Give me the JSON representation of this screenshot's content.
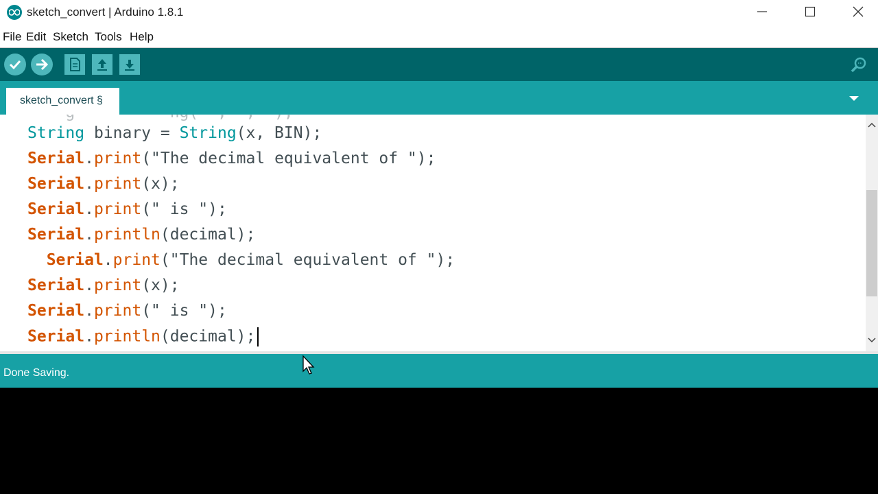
{
  "window": {
    "title": "sketch_convert | Arduino 1.8.1",
    "app_icon": "arduino-infinity-icon",
    "controls": [
      "minimize-icon",
      "maximize-icon",
      "close-icon"
    ]
  },
  "menu": [
    "File",
    "Edit",
    "Sketch",
    "Tools",
    "Help"
  ],
  "toolbar": {
    "buttons": [
      "verify-icon",
      "upload-icon",
      "new-icon",
      "open-icon",
      "save-icon"
    ],
    "right": "serial-monitor-icon"
  },
  "tabs": [
    {
      "label": "sketch_convert §"
    }
  ],
  "editor": {
    "lines": [
      [
        {
          "t": "String",
          "c": "ty"
        },
        {
          "t": " binary = "
        },
        {
          "t": "String",
          "c": "ty"
        },
        {
          "t": "(x, BIN);"
        }
      ],
      [
        {
          "t": "Serial",
          "c": "kw"
        },
        {
          "t": "."
        },
        {
          "t": "print",
          "c": "fn"
        },
        {
          "t": "(\"The decimal equivalent of \");"
        }
      ],
      [
        {
          "t": "Serial",
          "c": "kw"
        },
        {
          "t": "."
        },
        {
          "t": "print",
          "c": "fn"
        },
        {
          "t": "(x);"
        }
      ],
      [
        {
          "t": "Serial",
          "c": "kw"
        },
        {
          "t": "."
        },
        {
          "t": "print",
          "c": "fn"
        },
        {
          "t": "(\" is \");"
        }
      ],
      [
        {
          "t": "Serial",
          "c": "kw"
        },
        {
          "t": "."
        },
        {
          "t": "println",
          "c": "fn"
        },
        {
          "t": "(decimal);"
        }
      ],
      [
        {
          "t": "  "
        },
        {
          "t": "Serial",
          "c": "kw"
        },
        {
          "t": "."
        },
        {
          "t": "print",
          "c": "fn"
        },
        {
          "t": "(\"The decimal equivalent of \");"
        }
      ],
      [
        {
          "t": "Serial",
          "c": "kw"
        },
        {
          "t": "."
        },
        {
          "t": "print",
          "c": "fn"
        },
        {
          "t": "(x);"
        }
      ],
      [
        {
          "t": "Serial",
          "c": "kw"
        },
        {
          "t": "."
        },
        {
          "t": "print",
          "c": "fn"
        },
        {
          "t": "(\" is \");"
        }
      ],
      [
        {
          "t": "Serial",
          "c": "kw"
        },
        {
          "t": "."
        },
        {
          "t": "println",
          "c": "fn"
        },
        {
          "t": "(decimal);"
        }
      ]
    ]
  },
  "status": {
    "message": "Done Saving."
  },
  "colors": {
    "toolbar": "#006468",
    "tabbar": "#17a1a5",
    "keyword": "#d35400",
    "type": "#00979c"
  }
}
